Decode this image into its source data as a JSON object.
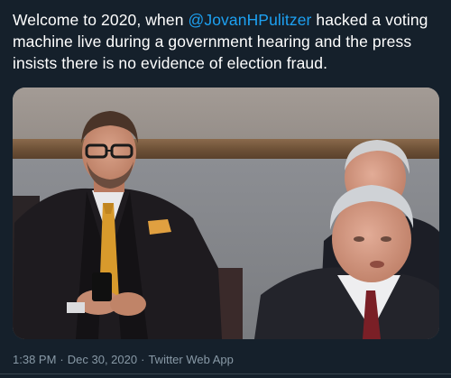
{
  "tweet": {
    "text_before": "Welcome to 2020, when ",
    "mention": "@JovanHPulitzer",
    "text_after": " hacked a voting machine live during a government hearing and the press insists there is no evidence of election fraud."
  },
  "meta": {
    "time": "1:38 PM",
    "separator": "·",
    "date": "Dec 30, 2020",
    "source": "Twitter Web App"
  },
  "colors": {
    "background": "#15202b",
    "text": "#ffffff",
    "link": "#1da1f2",
    "muted": "#8899a6"
  }
}
